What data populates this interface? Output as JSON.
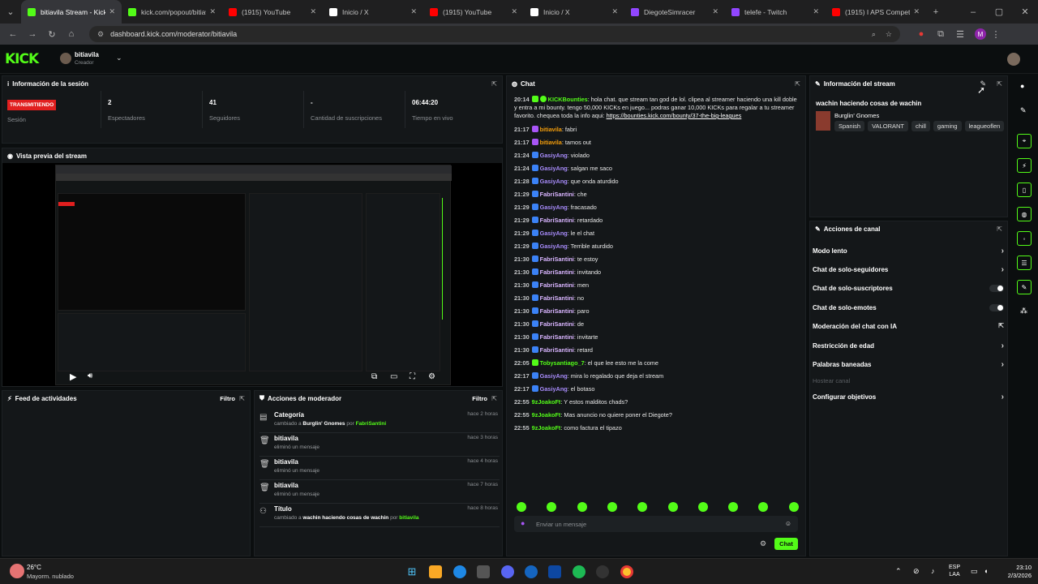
{
  "browser": {
    "tabs": [
      {
        "title": "bitiavila Stream - Kick",
        "icon": "kick-icon",
        "color": "#53fc18",
        "active": true
      },
      {
        "title": "kick.com/popout/bitiavila",
        "icon": "kick-icon",
        "color": "#53fc18"
      },
      {
        "title": "(1915) YouTube",
        "icon": "youtube-icon",
        "color": "#ff0000"
      },
      {
        "title": "Inicio / X",
        "icon": "x-icon",
        "color": "#ffffff"
      },
      {
        "title": "(1915) YouTube",
        "icon": "youtube-icon",
        "color": "#ff0000"
      },
      {
        "title": "Inicio / X",
        "icon": "x-icon",
        "color": "#ffffff"
      },
      {
        "title": "DiegoteSimracer",
        "icon": "twitch-icon",
        "color": "#9146ff"
      },
      {
        "title": "telefe - Twitch",
        "icon": "twitch-icon",
        "color": "#9146ff"
      },
      {
        "title": "(1915) I APS Compet",
        "icon": "youtube-icon",
        "color": "#ff0000"
      }
    ],
    "url": "dashboard.kick.com/moderator/bitiavila",
    "profile": "M"
  },
  "header": {
    "logo": "KICK",
    "channel": "bitiavila",
    "role": "Creador"
  },
  "session": {
    "title": "Información de la sesión",
    "live": "TRANSMITIENDO",
    "live_label": "Sesión",
    "stats": [
      {
        "value": "2",
        "label": "Espectadores"
      },
      {
        "value": "41",
        "label": "Seguidores"
      },
      {
        "value": "-",
        "label": "Cantidad de suscripciones"
      },
      {
        "value": "06:44:20",
        "label": "Tiempo en vivo"
      }
    ]
  },
  "preview": {
    "title": "Vista previa del stream"
  },
  "feed": {
    "title": "Feed de actividades",
    "filter": "Filtro"
  },
  "mod": {
    "title": "Acciones de moderador",
    "filter": "Filtro",
    "rows": [
      {
        "icon": "category-icon",
        "name": "Categoría",
        "sub_pre": "cambiado a",
        "sub_val": "Burglin' Gnomes",
        "sub_by": "por",
        "sub_user": "FabriSantini",
        "time": "hace 2 horas"
      },
      {
        "icon": "trash-icon",
        "name": "bitiavila",
        "sub_pre": "eliminó un mensaje",
        "time": "hace 3 horas"
      },
      {
        "icon": "trash-icon",
        "name": "bitiavila",
        "sub_pre": "eliminó un mensaje",
        "time": "hace 4 horas"
      },
      {
        "icon": "trash-icon",
        "name": "bitiavila",
        "sub_pre": "eliminó un mensaje",
        "time": "hace 7 horas"
      },
      {
        "icon": "title-icon",
        "name": "Título",
        "sub_pre": "cambiado a",
        "sub_val": "wachin haciendo cosas de wachin",
        "sub_by": "por",
        "sub_user": "bitiavila",
        "time": "hace 8 horas"
      }
    ]
  },
  "chat": {
    "title": "Chat",
    "input_placeholder": "Enviar un mensaje",
    "send": "Chat",
    "first": {
      "time": "20:14",
      "user": "KICKBounties",
      "text": ": hola chat. que stream tan god de lol. clipea al streamer haciendo una kill doble y entra a mi bounty. tengo 50,000 KICKs en juego... podras ganar 10,000 KICKs para regalar a tu streamer favorito. chequea toda la info aqui:",
      "link": "https://bounties.kick.com/bounty/37-the-big-leagues"
    },
    "messages": [
      {
        "time": "21:17",
        "user": "bitiavila",
        "color": "#f59e0b",
        "text": ": fabri",
        "badge": "#a855f7"
      },
      {
        "time": "21:17",
        "user": "bitiavila",
        "color": "#f59e0b",
        "text": ": tamos out",
        "badge": "#a855f7"
      },
      {
        "time": "21:24",
        "user": "GasiyAng",
        "color": "#a78bfa",
        "text": ": violado",
        "badge": "#3b82f6"
      },
      {
        "time": "21:24",
        "user": "GasiyAng",
        "color": "#a78bfa",
        "text": ": salgan me saco",
        "badge": "#3b82f6"
      },
      {
        "time": "21:28",
        "user": "GasiyAng",
        "color": "#a78bfa",
        "text": ": que onda aturdido",
        "badge": "#3b82f6"
      },
      {
        "time": "21:29",
        "user": "FabriSantini",
        "color": "#d8b4fe",
        "text": ": che",
        "badge": "#3b82f6"
      },
      {
        "time": "21:29",
        "user": "GasiyAng",
        "color": "#a78bfa",
        "text": ": fracasado",
        "badge": "#3b82f6"
      },
      {
        "time": "21:29",
        "user": "FabriSantini",
        "color": "#d8b4fe",
        "text": ": retardado",
        "badge": "#3b82f6"
      },
      {
        "time": "21:29",
        "user": "GasiyAng",
        "color": "#a78bfa",
        "text": ": le el chat",
        "badge": "#3b82f6"
      },
      {
        "time": "21:29",
        "user": "GasiyAng",
        "color": "#a78bfa",
        "text": ": Terrible aturdido",
        "badge": "#3b82f6"
      },
      {
        "time": "21:30",
        "user": "FabriSantini",
        "color": "#d8b4fe",
        "text": ": te estoy",
        "badge": "#3b82f6"
      },
      {
        "time": "21:30",
        "user": "FabriSantini",
        "color": "#d8b4fe",
        "text": ": invitando",
        "badge": "#3b82f6"
      },
      {
        "time": "21:30",
        "user": "FabriSantini",
        "color": "#d8b4fe",
        "text": ": men",
        "badge": "#3b82f6"
      },
      {
        "time": "21:30",
        "user": "FabriSantini",
        "color": "#d8b4fe",
        "text": ": no",
        "badge": "#3b82f6"
      },
      {
        "time": "21:30",
        "user": "FabriSantini",
        "color": "#d8b4fe",
        "text": ": paro",
        "badge": "#3b82f6"
      },
      {
        "time": "21:30",
        "user": "FabriSantini",
        "color": "#d8b4fe",
        "text": ": de",
        "badge": "#3b82f6"
      },
      {
        "time": "21:30",
        "user": "FabriSantini",
        "color": "#d8b4fe",
        "text": ": invitarte",
        "badge": "#3b82f6"
      },
      {
        "time": "21:30",
        "user": "FabriSantini",
        "color": "#d8b4fe",
        "text": ": retard",
        "badge": "#3b82f6"
      },
      {
        "time": "22:05",
        "user": "Tobysantiago_7",
        "color": "#53fc18",
        "text": ": el que lee esto me la come",
        "badge": "#53fc18"
      },
      {
        "time": "22:17",
        "user": "GasiyAng",
        "color": "#a78bfa",
        "text": ": mira lo regalado que deja el stream",
        "badge": "#3b82f6"
      },
      {
        "time": "22:17",
        "user": "GasiyAng",
        "color": "#a78bfa",
        "text": ": el botaso",
        "badge": "#3b82f6"
      },
      {
        "time": "22:55",
        "user": "9zJoakoFt",
        "color": "#53fc18",
        "text": ": Y estos malditos chads?",
        "badge": ""
      },
      {
        "time": "22:55",
        "user": "9zJoakoFt",
        "color": "#53fc18",
        "text": ": Mas anuncio no quiere poner el Diegote?",
        "badge": ""
      },
      {
        "time": "22:55",
        "user": "9zJoakoFt",
        "color": "#53fc18",
        "text": ": como factura el tipazo",
        "badge": ""
      }
    ]
  },
  "stream_info": {
    "title": "Información del stream",
    "stream_title": "wachin haciendo cosas de wachin",
    "category": "Burglin' Gnomes",
    "tags": [
      "Spanish",
      "VALORANT",
      "chill",
      "gaming",
      "leagueoflen"
    ]
  },
  "actions": {
    "title": "Acciones de canal",
    "items": [
      {
        "label": "Modo lento",
        "control": "chevron"
      },
      {
        "label": "Chat de solo-seguidores",
        "control": "chevron"
      },
      {
        "label": "Chat de solo-suscriptores",
        "control": "toggle"
      },
      {
        "label": "Chat de solo-emotes",
        "control": "toggle"
      },
      {
        "label": "Moderación del chat con IA",
        "control": "external"
      },
      {
        "label": "Restricción de edad",
        "control": "chevron"
      },
      {
        "label": "Palabras baneadas",
        "control": "chevron"
      },
      {
        "label": "Hostear canal",
        "control": "none",
        "disabled": true
      },
      {
        "label": "Configurar objetivos",
        "control": "chevron"
      }
    ]
  },
  "taskbar": {
    "weather_temp": "26°C",
    "weather_desc": "Mayorm. nublado",
    "lang1": "ESP",
    "lang2": "LAA",
    "time": "23:10",
    "date": "2/3/2026"
  }
}
